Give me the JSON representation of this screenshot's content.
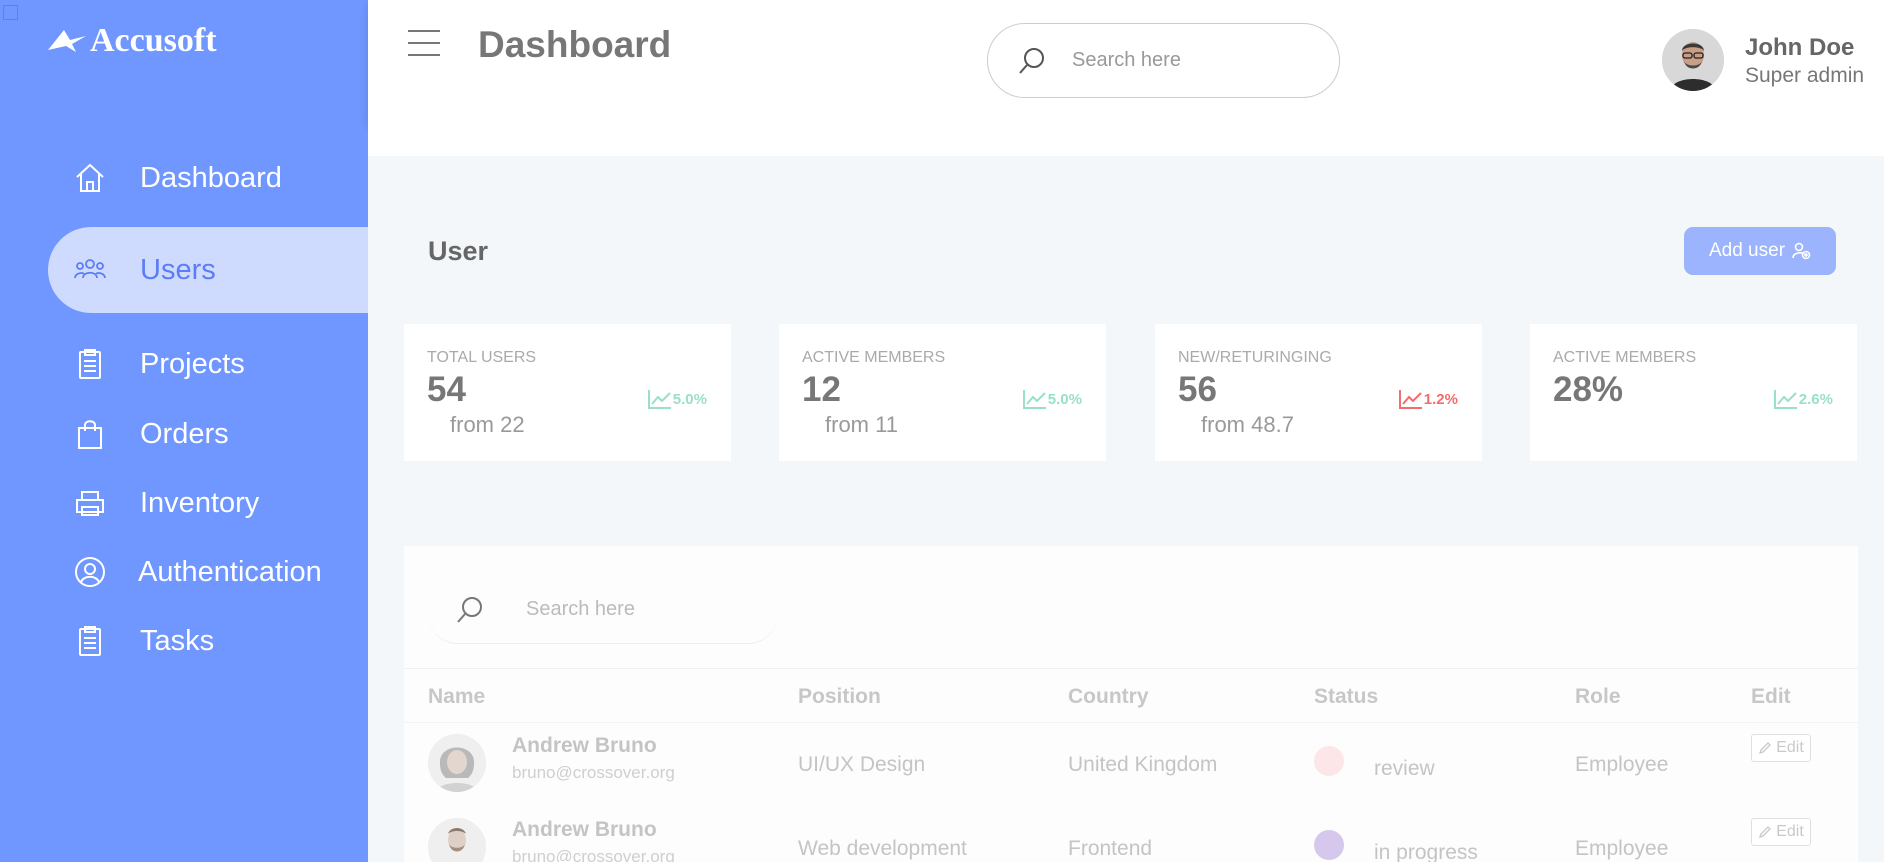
{
  "brand": {
    "name": "Accusoft"
  },
  "sidebar": {
    "items": [
      {
        "label": "Dashboard",
        "icon": "home-icon"
      },
      {
        "label": "Users",
        "icon": "users-icon",
        "active": true
      },
      {
        "label": "Projects",
        "icon": "clipboard-icon"
      },
      {
        "label": "Orders",
        "icon": "shopping-bag-icon"
      },
      {
        "label": "Inventory",
        "icon": "printer-icon"
      },
      {
        "label": "Authentication",
        "icon": "user-circle-icon"
      },
      {
        "label": "Tasks",
        "icon": "clipboard-icon"
      }
    ]
  },
  "header": {
    "title": "Dashboard",
    "search_placeholder": "Search here",
    "user": {
      "name": "John Doe",
      "role": "Super admin"
    }
  },
  "main": {
    "section_title": "User",
    "add_user_label": "Add user",
    "stats": [
      {
        "label": "TOTAL USERS",
        "value": "54",
        "sub": "from 22",
        "trend": "5.0%",
        "direction": "up"
      },
      {
        "label": "ACTIVE MEMBERS",
        "value": "12",
        "sub": "from 11",
        "trend": "5.0%",
        "direction": "up"
      },
      {
        "label": "NEW/RETURINGING",
        "value": "56",
        "sub": "from 48.7",
        "trend": "1.2%",
        "direction": "down"
      },
      {
        "label": "ACTIVE MEMBERS",
        "value": "28%",
        "sub": "",
        "trend": "2.6%",
        "direction": "up"
      }
    ],
    "table": {
      "search_placeholder": "Search here",
      "columns": [
        "Name",
        "Position",
        "Country",
        "Status",
        "Role",
        "Edit"
      ],
      "rows": [
        {
          "name": "Andrew Bruno",
          "email": "bruno@crossover.org",
          "position": "UI/UX Design",
          "country": "United Kingdom",
          "status": "review",
          "status_color": "#fde6e8",
          "role": "Employee",
          "edit": "Edit"
        },
        {
          "name": "Andrew Bruno",
          "email": "bruno@crossover.org",
          "position": "Web development",
          "country": "Frontend",
          "status": "in progress",
          "status_color": "#d6c8ec",
          "role": "Employee",
          "edit": "Edit"
        }
      ]
    }
  },
  "colors": {
    "sidebar": "#7096ff",
    "active_item_bg": "#cfdbfe",
    "accent": "#5b7df5",
    "trend_up": "#9adfc9",
    "trend_down": "#f26d6d"
  }
}
